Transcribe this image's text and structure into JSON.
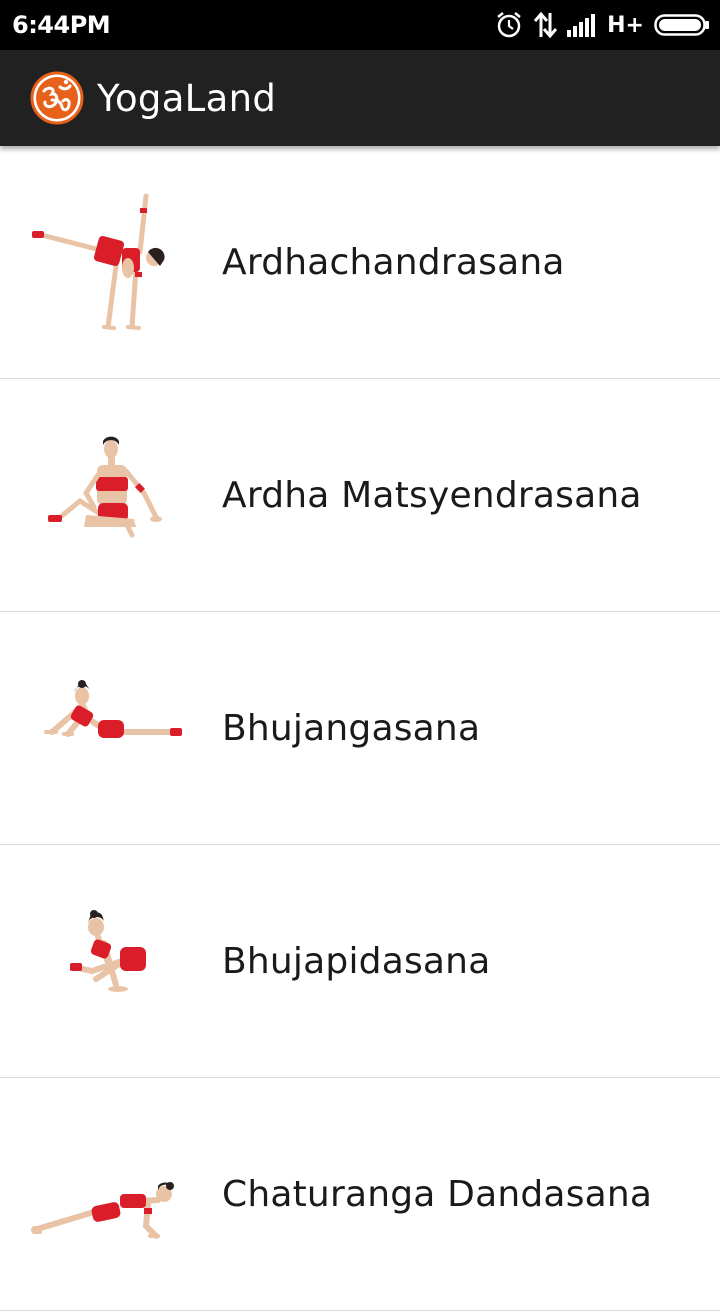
{
  "status_bar": {
    "time": "6:44PM",
    "network_type": "H+",
    "icons": [
      "alarm-icon",
      "data-transfer-icon",
      "signal-icon",
      "battery-icon"
    ]
  },
  "app_bar": {
    "title": "YogaLand",
    "logo_icon": "om-icon",
    "background": "#212121",
    "logo_color": "#e8611a"
  },
  "poses": [
    {
      "name": "Ardhachandrasana",
      "thumb_icon": "ardhachandrasana-pose-image"
    },
    {
      "name": "Ardha Matsyendrasana",
      "thumb_icon": "ardha-matsyendrasana-pose-image"
    },
    {
      "name": "Bhujangasana",
      "thumb_icon": "bhujangasana-pose-image"
    },
    {
      "name": "Bhujapidasana",
      "thumb_icon": "bhujapidasana-pose-image"
    },
    {
      "name": "Chaturanga Dandasana",
      "thumb_icon": "chaturanga-dandasana-pose-image"
    }
  ],
  "colors": {
    "outfit_red": "#d91e2a",
    "skin": "#e9c3a6",
    "divider": "#d9d9d9"
  }
}
